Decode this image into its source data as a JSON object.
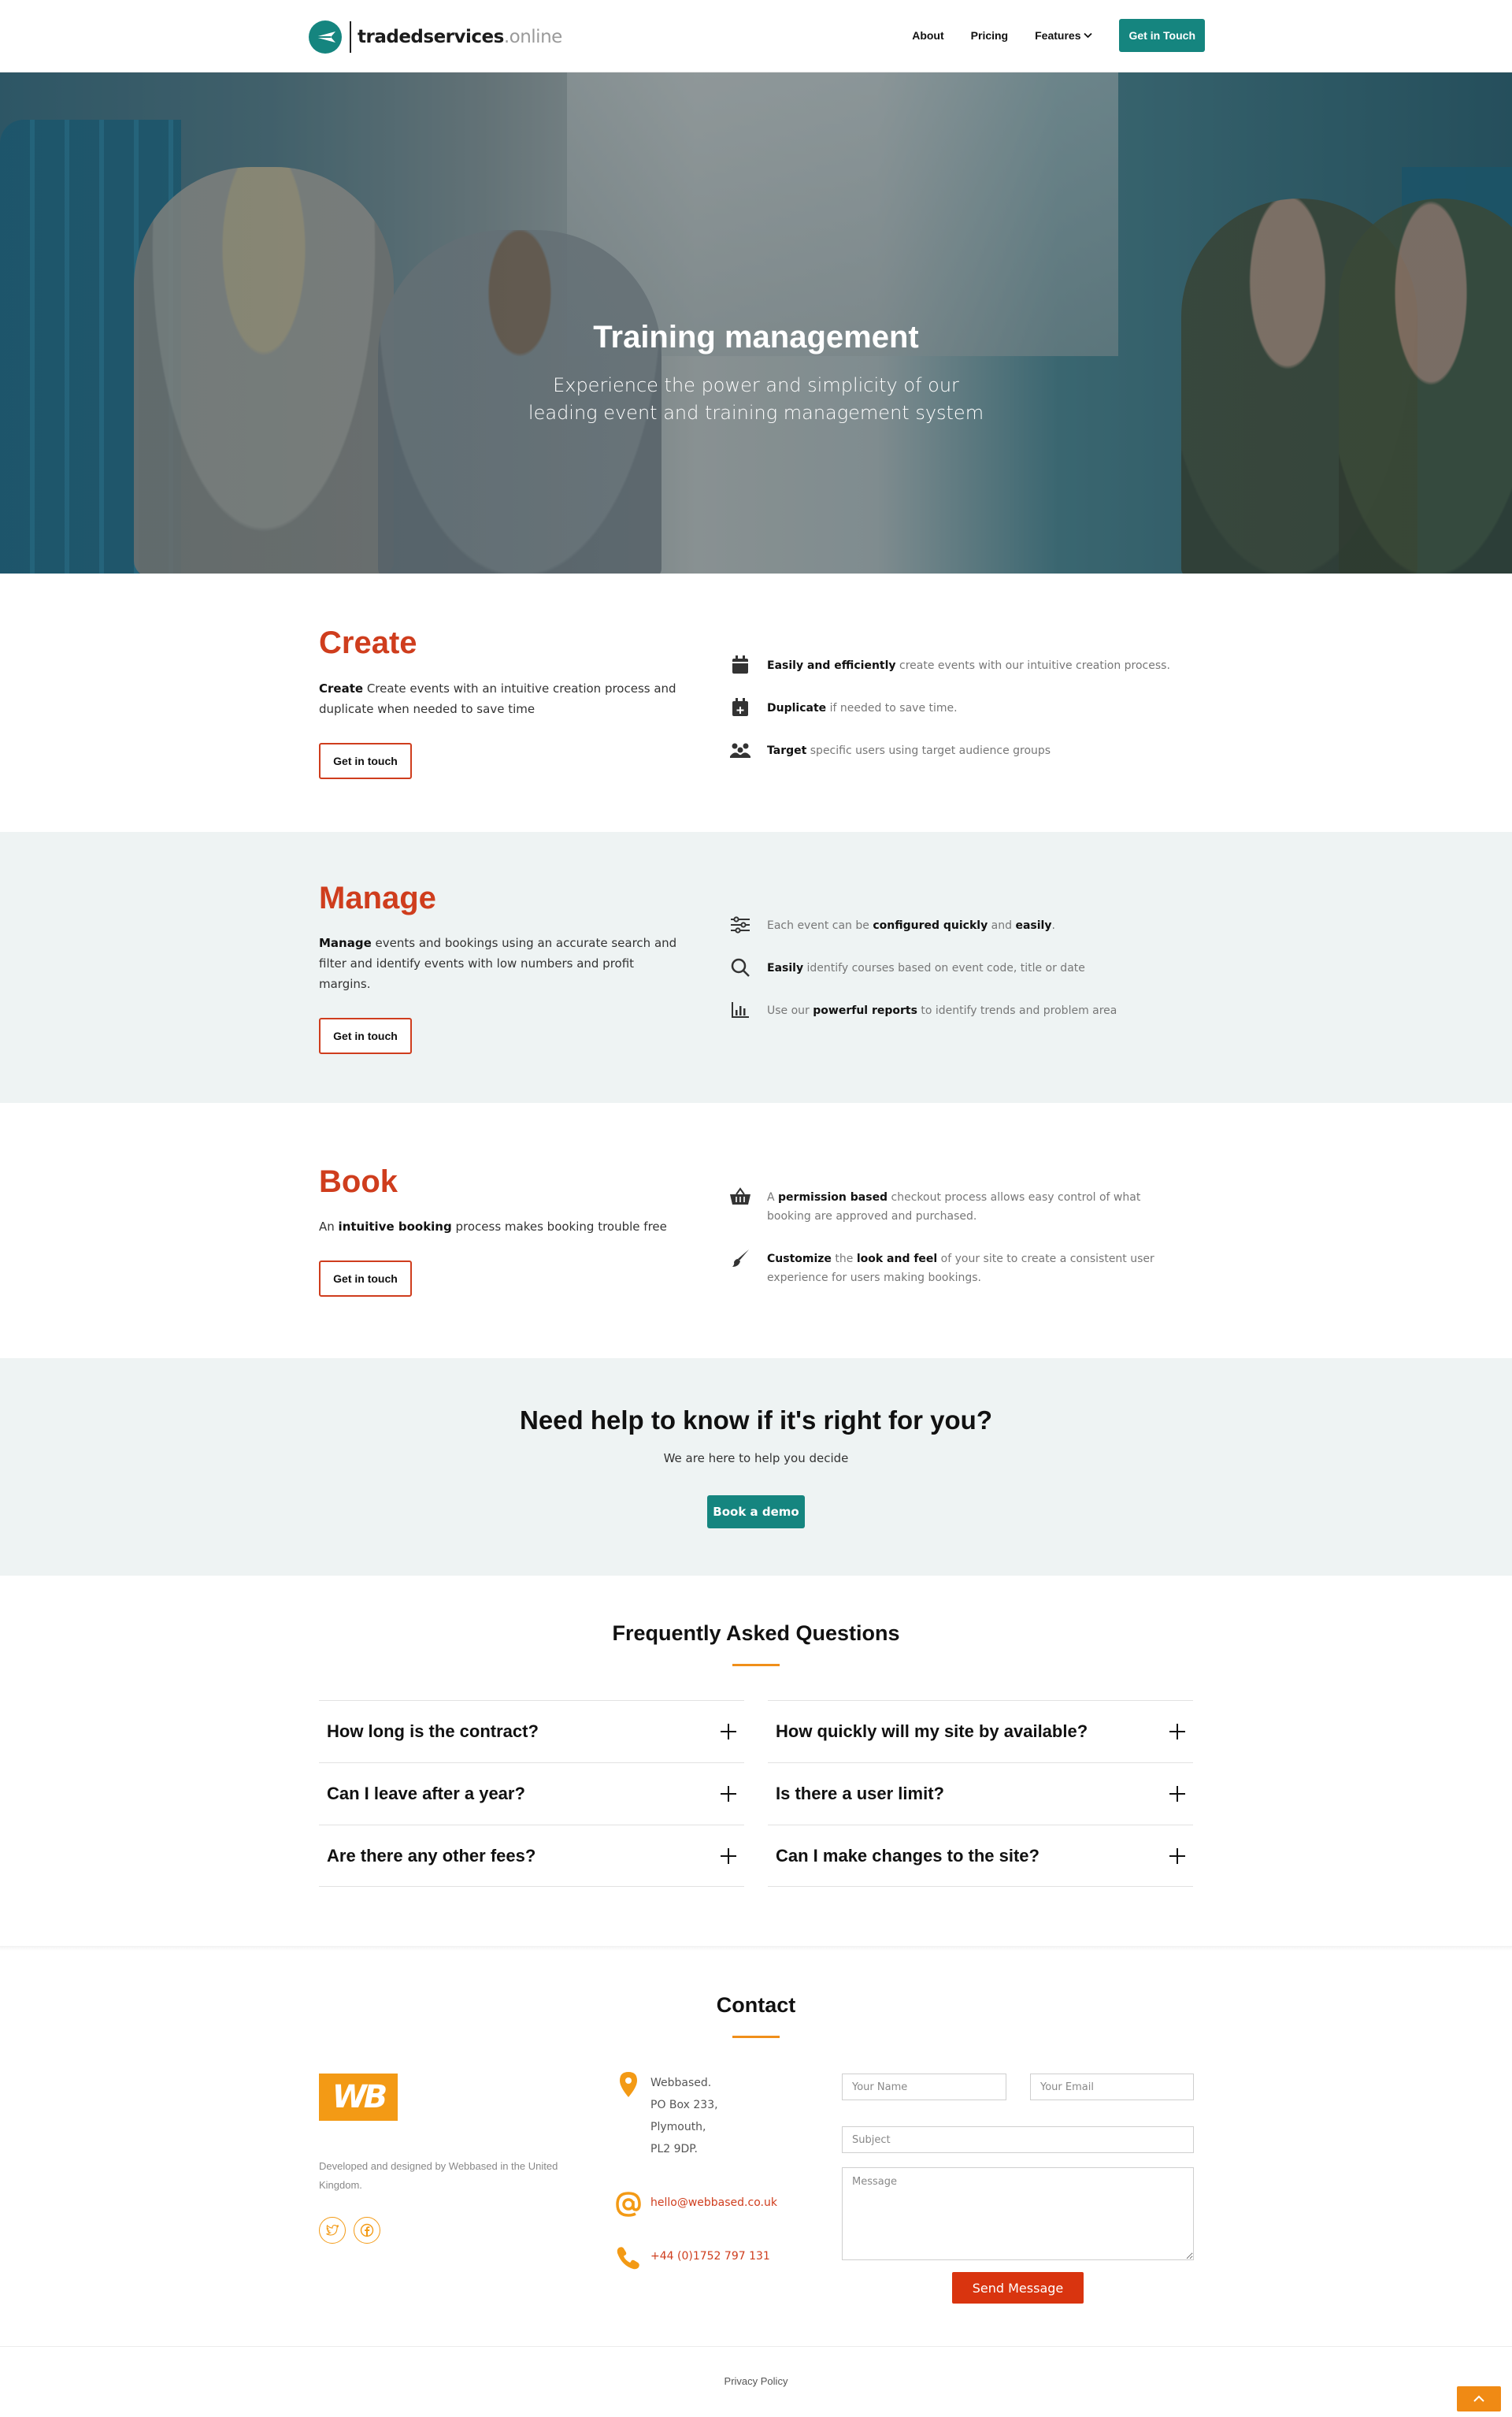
{
  "brand": {
    "name_bold": "tradedservices",
    "name_light": ".online",
    "accent": "#15857f",
    "red": "#cf3d1d",
    "orange": "#f39a15"
  },
  "nav": {
    "items": [
      {
        "label": "About"
      },
      {
        "label": "Pricing"
      },
      {
        "label": "Features"
      }
    ],
    "cta": "Get in Touch"
  },
  "hero": {
    "title": "Training management",
    "subtitle": "Experience the power and simplicity of our leading event and training management system"
  },
  "create": {
    "title": "Create",
    "desc_bold": "Create",
    "desc": " Create events with an intuitive creation process and duplicate when needed to save time",
    "button": "Get in touch",
    "features": [
      {
        "icon": "calendar-icon",
        "bold": "Easily and efficiently",
        "text": " create events with our intuitive creation process."
      },
      {
        "icon": "calendar-plus-icon",
        "bold": "Duplicate",
        "text": " if needed to save time."
      },
      {
        "icon": "audience-icon",
        "bold": "Target",
        "text": " specific users using target audience groups"
      }
    ]
  },
  "manage": {
    "title": "Manage",
    "desc_bold": "Manage",
    "desc": " events and bookings using an accurate search and filter and identify events with low numbers and profit margins.",
    "button": "Get in touch",
    "features": [
      {
        "icon": "sliders-icon",
        "pre": "Each event can be ",
        "bold": "configured quickly",
        "mid": " and ",
        "bold2": "easily",
        "post": "."
      },
      {
        "icon": "search-icon",
        "bold": "Easily",
        "text": " identify courses based on event code, title or date"
      },
      {
        "icon": "bar-chart-icon",
        "pre": "Use our ",
        "bold": "powerful reports",
        "text": " to identify trends and problem area"
      }
    ]
  },
  "book": {
    "title": "Book",
    "desc_pre": "An ",
    "desc_bold": "intuitive booking",
    "desc": " process makes booking trouble free",
    "button": "Get in touch",
    "features": [
      {
        "icon": "basket-icon",
        "pre": "A ",
        "bold": "permission based",
        "text": " checkout process allows easy control of what booking are approved and purchased."
      },
      {
        "icon": "brush-icon",
        "bold": "Customize",
        "mid": " the ",
        "bold2": "look and feel",
        "text": " of your site to create a consistent user experience for users making bookings."
      }
    ]
  },
  "cta": {
    "title": "Need help to know if it's right for you?",
    "subtitle": "We are here to help you decide",
    "button": "Book a demo"
  },
  "faq": {
    "title": "Frequently Asked Questions",
    "left": [
      "How long is the contract?",
      "Can I leave after a year?",
      "Are there any other fees?"
    ],
    "right": [
      "How quickly will my site by available?",
      "Is there a user limit?",
      "Can I make changes to the site?"
    ]
  },
  "contact": {
    "title": "Contact",
    "logo_text": "WB",
    "developed": "Developed and designed by Webbased in the United Kingdom.",
    "address": [
      "Webbased.",
      "PO Box 233,",
      "Plymouth,",
      "PL2 9DP."
    ],
    "email": "hello@webbased.co.uk",
    "phone": "+44 (0)1752 797 131",
    "form": {
      "name_placeholder": "Your Name",
      "email_placeholder": "Your Email",
      "subject_placeholder": "Subject",
      "message_placeholder": "Message",
      "send": "Send Message"
    }
  },
  "footer": {
    "privacy": "Privacy Policy"
  }
}
